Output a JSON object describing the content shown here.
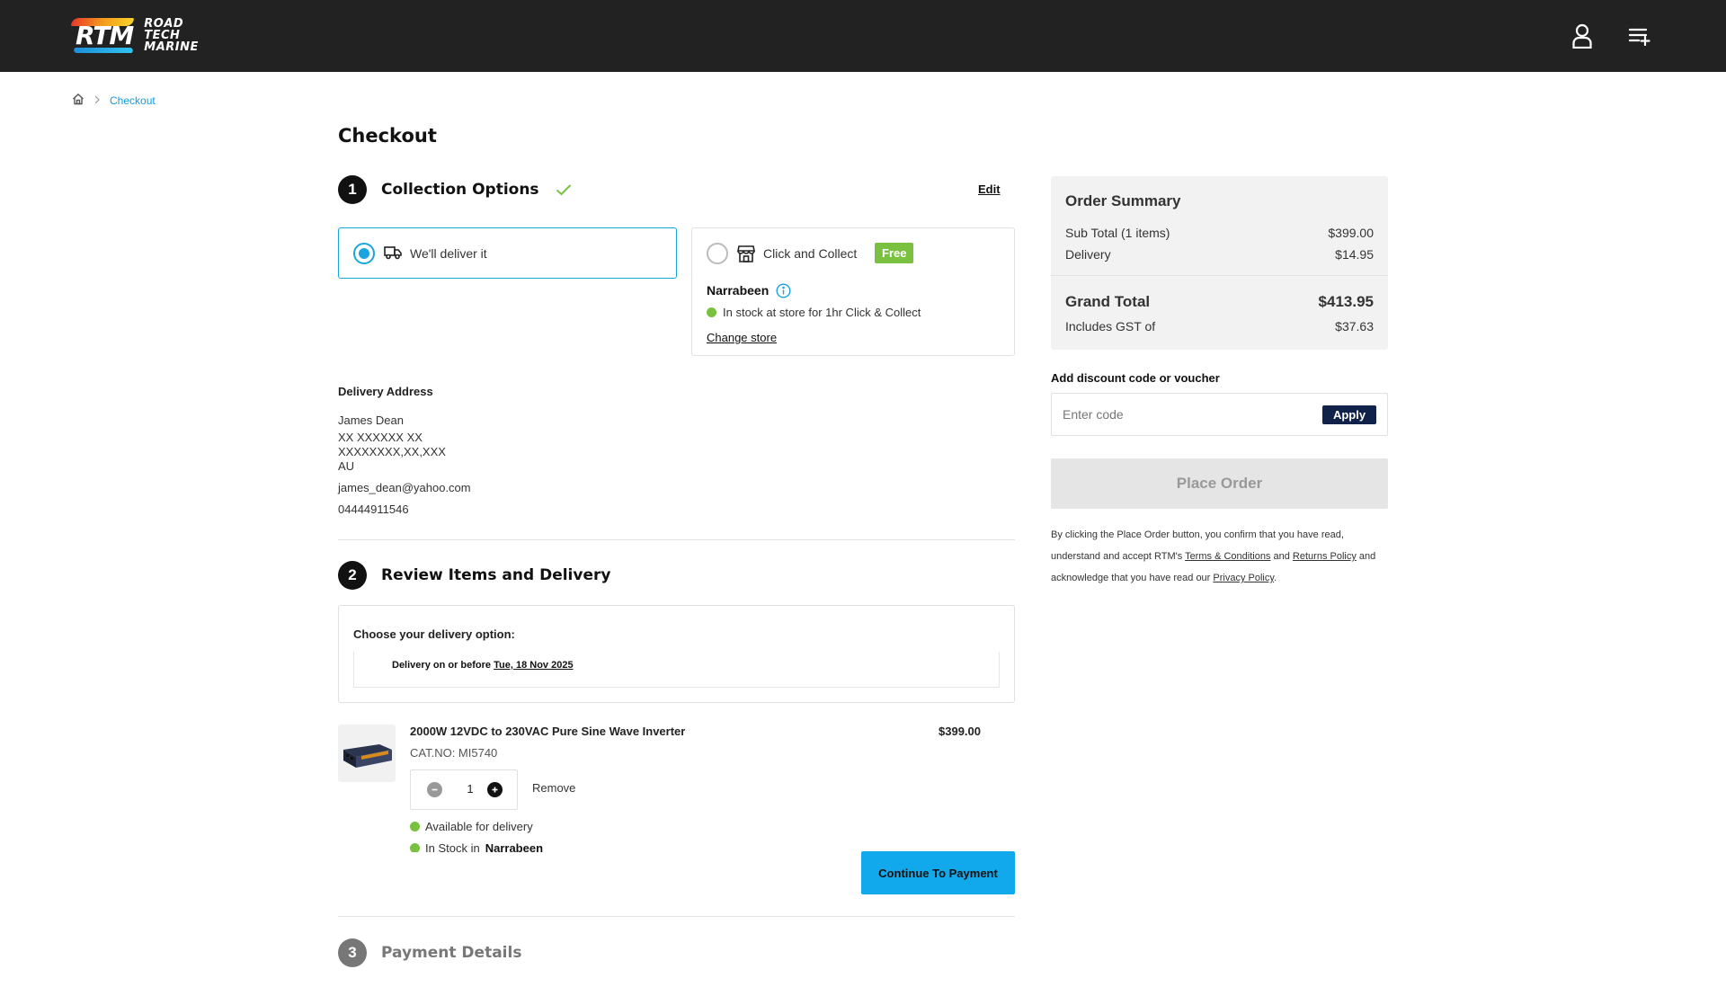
{
  "header": {
    "logo_main": "RTM",
    "logo_words": [
      "ROAD",
      "TECH",
      "MARINE"
    ],
    "icons": [
      "user-icon",
      "list-add-icon"
    ]
  },
  "breadcrumb": {
    "home_icon": "home-icon",
    "current": "Checkout"
  },
  "page_title": "Checkout",
  "step1": {
    "number": "1",
    "title": "Collection Options",
    "edit_label": "Edit",
    "deliver_option": {
      "label": "We'll deliver it",
      "selected": true
    },
    "collect_option": {
      "label": "Click and Collect",
      "badge": "Free",
      "store": "Narrabeen",
      "stock_text": "In stock at store for 1hr Click & Collect",
      "change_store": "Change store"
    }
  },
  "address": {
    "title": "Delivery Address",
    "name": "James Dean",
    "line1": "XX XXXXXX XX",
    "line2": "XXXXXXXX,XX,XXX",
    "country": "AU",
    "email": "james_dean@yahoo.com",
    "phone": "04444911546"
  },
  "step2": {
    "number": "2",
    "title": "Review Items and Delivery",
    "choose_label": "Choose your delivery option:",
    "delivery_prefix": "Delivery on or before",
    "delivery_date": "Tue, 18 Nov 2025",
    "product": {
      "name": "2000W 12VDC to 230VAC Pure Sine Wave Inverter",
      "cat_no": "CAT.NO: MI5740",
      "price": "$399.00",
      "quantity": "1",
      "remove": "Remove",
      "availability": "Available for delivery",
      "stock_prefix": "In Stock in",
      "stock_store": "Narrabeen"
    },
    "continue_label": "Continue To Payment"
  },
  "step3": {
    "number": "3",
    "title": "Payment Details"
  },
  "summary": {
    "title": "Order Summary",
    "subtotal_label": "Sub Total (1 items)",
    "subtotal_value": "$399.00",
    "delivery_label": "Delivery",
    "delivery_value": "$14.95",
    "grand_label": "Grand Total",
    "grand_value": "$413.95",
    "gst_label": "Includes GST of",
    "gst_value": "$37.63"
  },
  "discount": {
    "title": "Add discount code or voucher",
    "placeholder": "Enter code",
    "apply_label": "Apply"
  },
  "place_order_label": "Place Order",
  "legal": {
    "t1": "By clicking the Place Order button, you confirm that you have read, understand and accept RTM's",
    "terms": "Terms & Conditions",
    "and": "and",
    "returns": "Returns Policy",
    "t2": "and acknowledge that you have read our",
    "privacy": "Privacy Policy",
    "end": "."
  },
  "colors": {
    "accent": "#12a9ec",
    "selected_border": "#1aa4de",
    "green": "#7ac142",
    "navy": "#10214a",
    "header": "#222222"
  }
}
